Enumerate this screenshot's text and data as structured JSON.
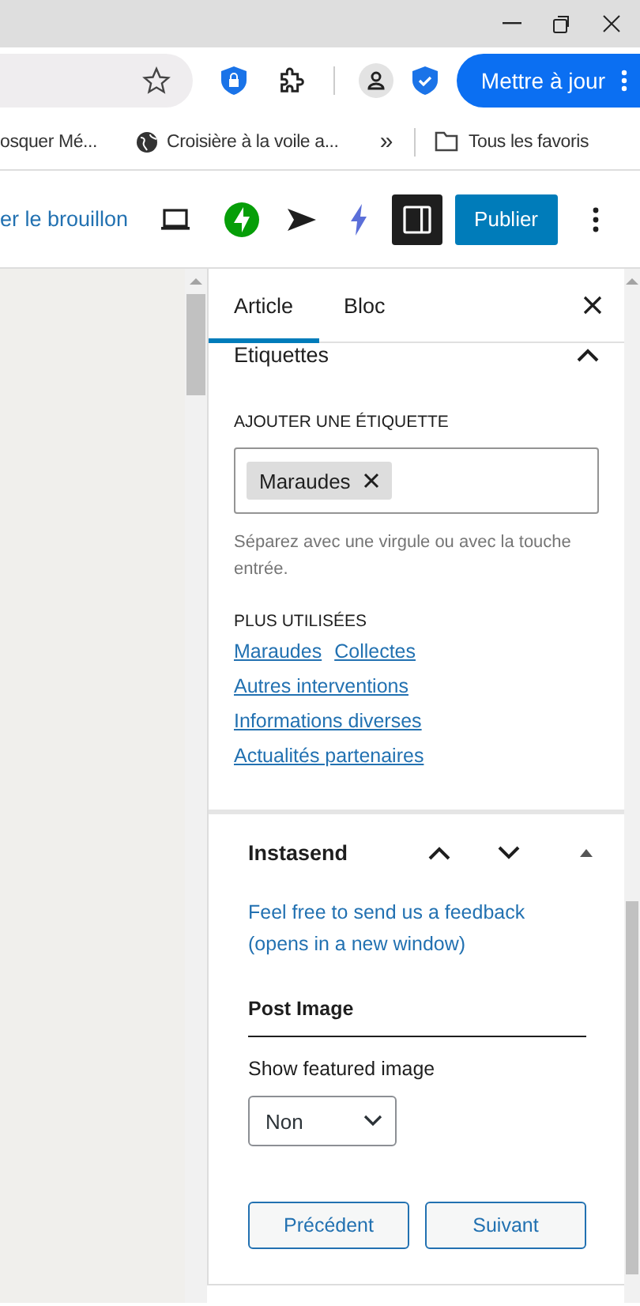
{
  "browser": {
    "update_button": "Mettre à jour",
    "bookmarks": [
      {
        "label": "osquer Mé...",
        "kind": "plain"
      },
      {
        "label": "Croisière à la voile a...",
        "kind": "globe"
      }
    ],
    "more_bookmarks": "»",
    "all_bookmarks": "Tous les favoris"
  },
  "toolbar": {
    "draft_link": "er le brouillon",
    "publish": "Publier",
    "sidebar_toggle": {
      "on": true
    }
  },
  "sidebar": {
    "tabs": [
      {
        "label": "Article",
        "selected": true
      },
      {
        "label": "Bloc",
        "selected": false
      }
    ],
    "tags": {
      "title": "Etiquettes",
      "expanded": true,
      "field_label": "AJOUTER UNE ÉTIQUETTE",
      "tokens": [
        "Maraudes"
      ],
      "help": "Séparez avec une virgule ou avec la touche entrée.",
      "most_used_label": "PLUS UTILISÉES",
      "most_used": [
        [
          "Maraudes",
          "Collectes"
        ],
        [
          "Autres interventions"
        ],
        [
          "Informations diverses"
        ],
        [
          "Actualités partenaires"
        ]
      ]
    },
    "instasend": {
      "title": "Instasend",
      "feedback_link": "Feel free to send us a feedback (opens in a new window)",
      "section": "Post Image",
      "select_label": "Show featured image",
      "select_value": "Non",
      "buttons": [
        "Précédent",
        "Suivant"
      ]
    }
  }
}
